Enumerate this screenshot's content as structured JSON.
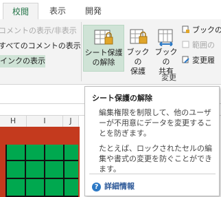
{
  "tabs": [
    {
      "label": "校閲"
    },
    {
      "label": "表示"
    },
    {
      "label": "開発"
    }
  ],
  "comments_group": {
    "item1": "コメントの表示/非表示",
    "item2": "すべてのコメントの表示",
    "item3": "インクの表示"
  },
  "changes_group": {
    "protect_sheet": {
      "line1": "シート保護",
      "line2": "の解除"
    },
    "protect_workbook": {
      "line1": "ブック",
      "line2": "の",
      "line3": "保護"
    },
    "share_workbook": {
      "line1": "ブック",
      "line2": "の",
      "line3": "共有"
    },
    "small1": "ブックの",
    "small2": "範囲の",
    "small3": "変更履",
    "label": "変更"
  },
  "columns": [
    "H",
    "I",
    "J"
  ],
  "tooltip": {
    "title": "シート保護の解除",
    "desc1": "編集権限を制限して、他のユーザーが不用意にデータを変更することを防ぎます。",
    "desc2": "たとえば、ロックされたセルの編集や書式の変更を防ぐことができます。",
    "help": "詳細情報"
  },
  "colors": {
    "accent": "#217346",
    "hover": "#cfe3d6",
    "sheet_red": "#c43a1e",
    "sheet_green": "#00a84f"
  }
}
